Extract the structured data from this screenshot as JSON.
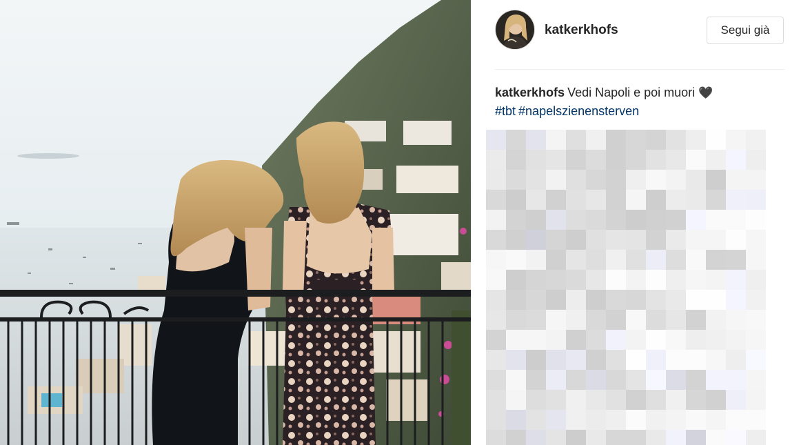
{
  "post": {
    "username": "katkerkhofs",
    "follow_button_label": "Segui già",
    "caption_username": "katkerkhofs",
    "caption_text": "Vedi Napoli e poi muori",
    "caption_emoji": "🖤",
    "hashtags": [
      "#tbt",
      "#napelszienensterven"
    ]
  },
  "colors": {
    "hashtag_link": "#003569",
    "text": "#262626",
    "border": "#dbdbdb"
  },
  "icons": {
    "caption_emoji": "black-heart-icon"
  }
}
